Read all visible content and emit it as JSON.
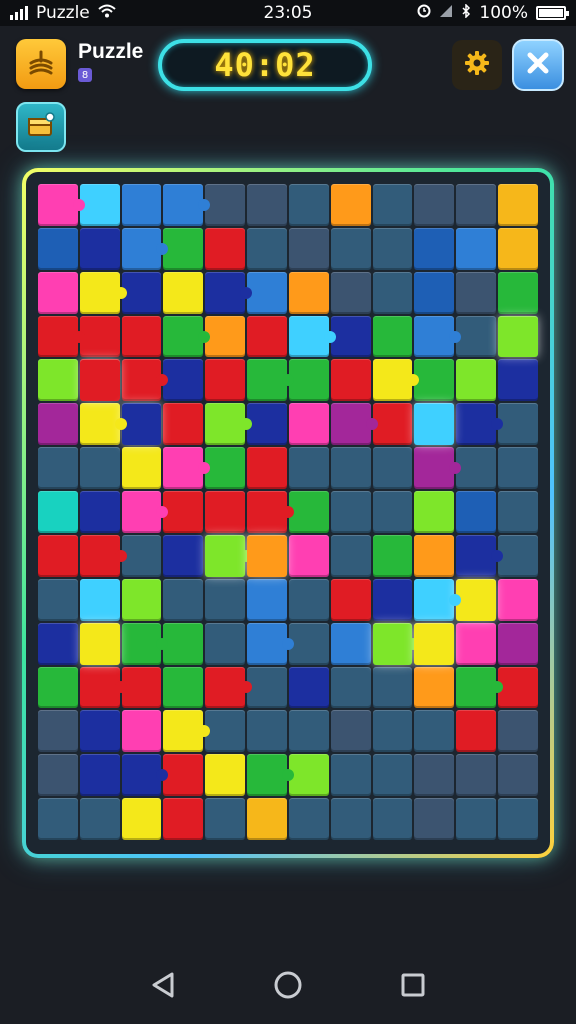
{
  "status_bar": {
    "carrier": "Puzzle",
    "time": "23:05",
    "battery_percent": "100%",
    "battery_level": 1.0,
    "icons": [
      "signal-icon",
      "wifi-icon",
      "alarm-icon",
      "signal-strength-icon",
      "bluetooth-icon",
      "battery-icon"
    ]
  },
  "header": {
    "title": "Puzzle",
    "badge": "8",
    "timer": "40:02",
    "icons": {
      "app": "puzzle-app-icon",
      "settings": "gear-icon",
      "close": "close-icon",
      "inventory": "chest-icon"
    }
  },
  "colors": {
    "accent_timer": "#ffe23a",
    "board_border": "#3de5a0",
    "background": "#1b1e24"
  },
  "board": {
    "columns": 12,
    "rows": 15,
    "palette": {
      "M": "#ff3fb2",
      "C": "#3fd0ff",
      "B": "#2f7fd6",
      "N": "#1c2fa0",
      "G": "#27b83a",
      "L": "#7ee62a",
      "Y": "#f4e81a",
      "O": "#ff9a1a",
      "R": "#e01c24",
      "P": "#a3279a",
      "T": "#18d2c0",
      "D": "#325c7a",
      "E": "#3c5470",
      "A": "#f6b71a",
      "S": "#1e5fb5"
    },
    "grid": [
      "MCBBEEDODEEA",
      "SNBGRDEDDSBA",
      "MYNYNBOEDSEG",
      "RRRGORCNGBDL",
      "LRRNRGGRYGLN",
      "PYNRLNMPRCND",
      "DDYMGRDDDPDD",
      "TNMRRRGDDLSD",
      "RRDNLOMDGOND",
      "DCLDDBDRNCYM",
      "NYGGDBDBLYMP",
      "GRRGRDNDDOGR",
      "ENMYDDDEDDRE",
      "ENNRYGLDDEEE",
      "DDYRDADDDEDD"
    ],
    "glowing": [
      "4-1",
      "5-2",
      "8-4",
      "8-5",
      "9-10",
      "10-8",
      "10-9",
      "5-9",
      "3-11",
      "10-1"
    ]
  }
}
